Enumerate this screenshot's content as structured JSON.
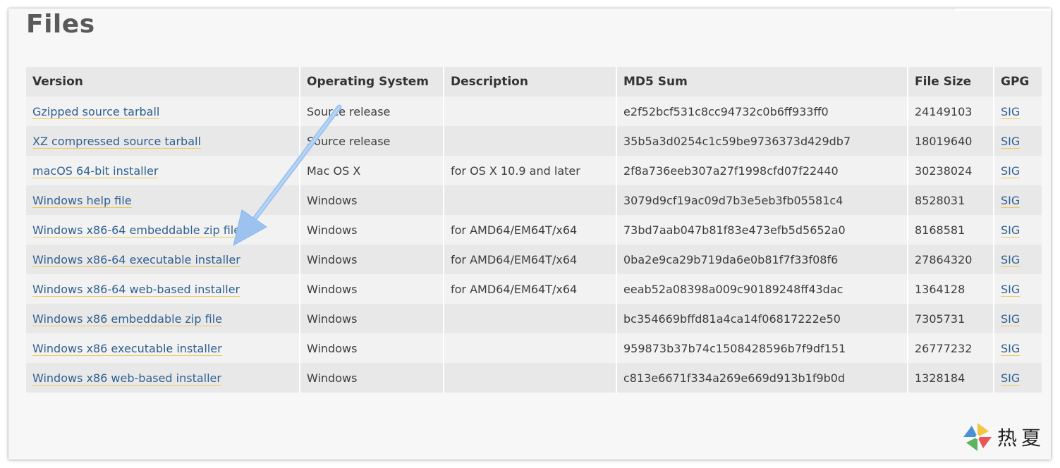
{
  "page": {
    "title": "Files"
  },
  "table": {
    "headers": [
      "Version",
      "Operating System",
      "Description",
      "MD5 Sum",
      "File Size",
      "GPG"
    ],
    "rows": [
      {
        "version": "Gzipped source tarball",
        "os": "Source release",
        "description": "",
        "md5": "e2f52bcf531c8cc94732c0b6ff933ff0",
        "size": "24149103",
        "gpg": "SIG"
      },
      {
        "version": "XZ compressed source tarball",
        "os": "Source release",
        "description": "",
        "md5": "35b5a3d0254c1c59be9736373d429db7",
        "size": "18019640",
        "gpg": "SIG"
      },
      {
        "version": "macOS 64-bit installer",
        "os": "Mac OS X",
        "description": "for OS X 10.9 and later",
        "md5": "2f8a736eeb307a27f1998cfd07f22440",
        "size": "30238024",
        "gpg": "SIG"
      },
      {
        "version": "Windows help file",
        "os": "Windows",
        "description": "",
        "md5": "3079d9cf19ac09d7b3e5eb3fb05581c4",
        "size": "8528031",
        "gpg": "SIG"
      },
      {
        "version": "Windows x86-64 embeddable zip file",
        "os": "Windows",
        "description": "for AMD64/EM64T/x64",
        "md5": "73bd7aab047b81f83e473efb5d5652a0",
        "size": "8168581",
        "gpg": "SIG"
      },
      {
        "version": "Windows x86-64 executable installer",
        "os": "Windows",
        "description": "for AMD64/EM64T/x64",
        "md5": "0ba2e9ca29b719da6e0b81f7f33f08f6",
        "size": "27864320",
        "gpg": "SIG"
      },
      {
        "version": "Windows x86-64 web-based installer",
        "os": "Windows",
        "description": "for AMD64/EM64T/x64",
        "md5": "eeab52a08398a009c90189248ff43dac",
        "size": "1364128",
        "gpg": "SIG"
      },
      {
        "version": "Windows x86 embeddable zip file",
        "os": "Windows",
        "description": "",
        "md5": "bc354669bffd81a4ca14f06817222e50",
        "size": "7305731",
        "gpg": "SIG"
      },
      {
        "version": "Windows x86 executable installer",
        "os": "Windows",
        "description": "",
        "md5": "959873b37b74c1508428596b7f9df151",
        "size": "26777232",
        "gpg": "SIG"
      },
      {
        "version": "Windows x86 web-based installer",
        "os": "Windows",
        "description": "",
        "md5": "c813e6671f334a269e669d913b1f9b0d",
        "size": "1328184",
        "gpg": "SIG"
      }
    ]
  },
  "annotation": {
    "icon": "arrow-pointer-icon",
    "color": "#9cc3f0"
  },
  "watermark": {
    "text": "热夏",
    "icon": "pinwheel-logo-icon"
  },
  "colors": {
    "link": "#2f5f8f",
    "link_underline": "#f0c85a",
    "header_bg": "#e8e8e8"
  }
}
